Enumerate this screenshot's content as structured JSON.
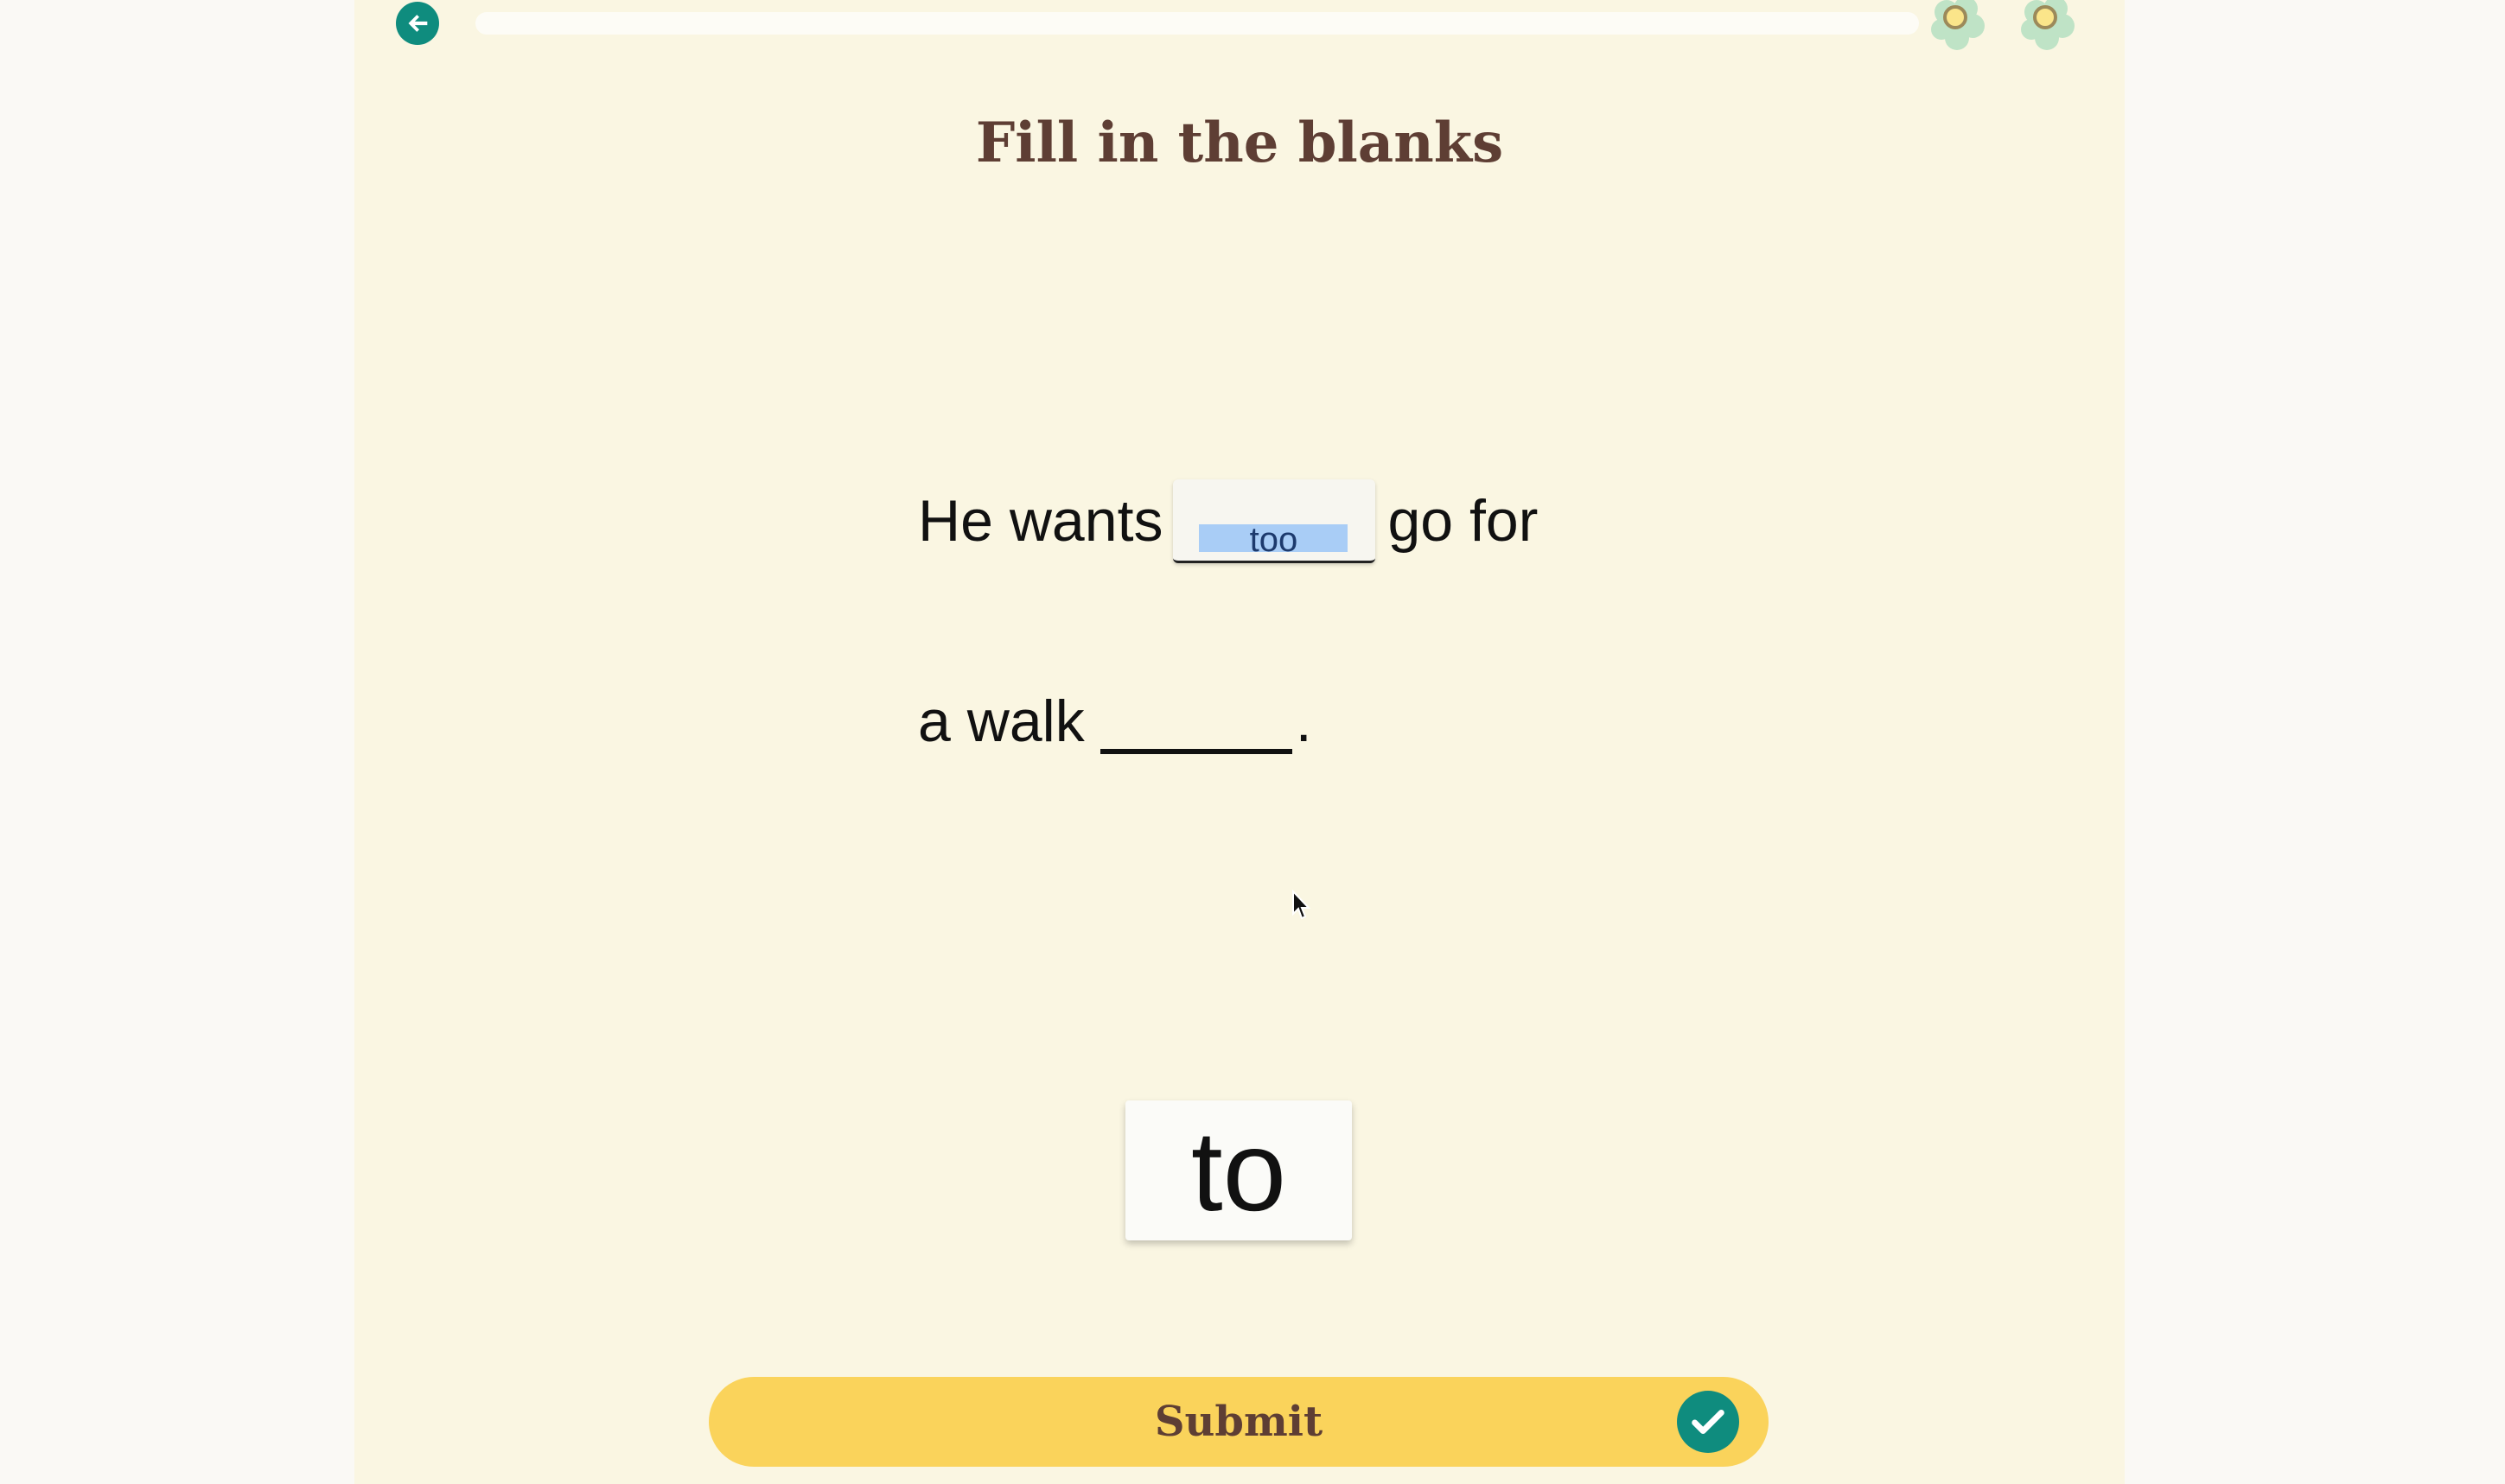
{
  "header": {
    "back_icon": "back-arrow-icon",
    "progress_fraction": 0.0,
    "rewards": [
      "flower-icon",
      "flower-icon"
    ]
  },
  "title": "Fill in the blanks",
  "sentence": {
    "line1_before": "He wants",
    "blank1_value": "too",
    "line1_after": "go for",
    "line2_before": "a walk",
    "line2_after": "."
  },
  "word_bank": [
    "to"
  ],
  "submit": {
    "label": "Submit",
    "icon": "checkmark-icon"
  },
  "colors": {
    "panel_background": "#faf6e2",
    "accent_teal": "#0f8c7e",
    "title_brown": "#5e3e34",
    "submit_yellow": "#fad35b",
    "selection_blue": "#a9cdf6"
  }
}
